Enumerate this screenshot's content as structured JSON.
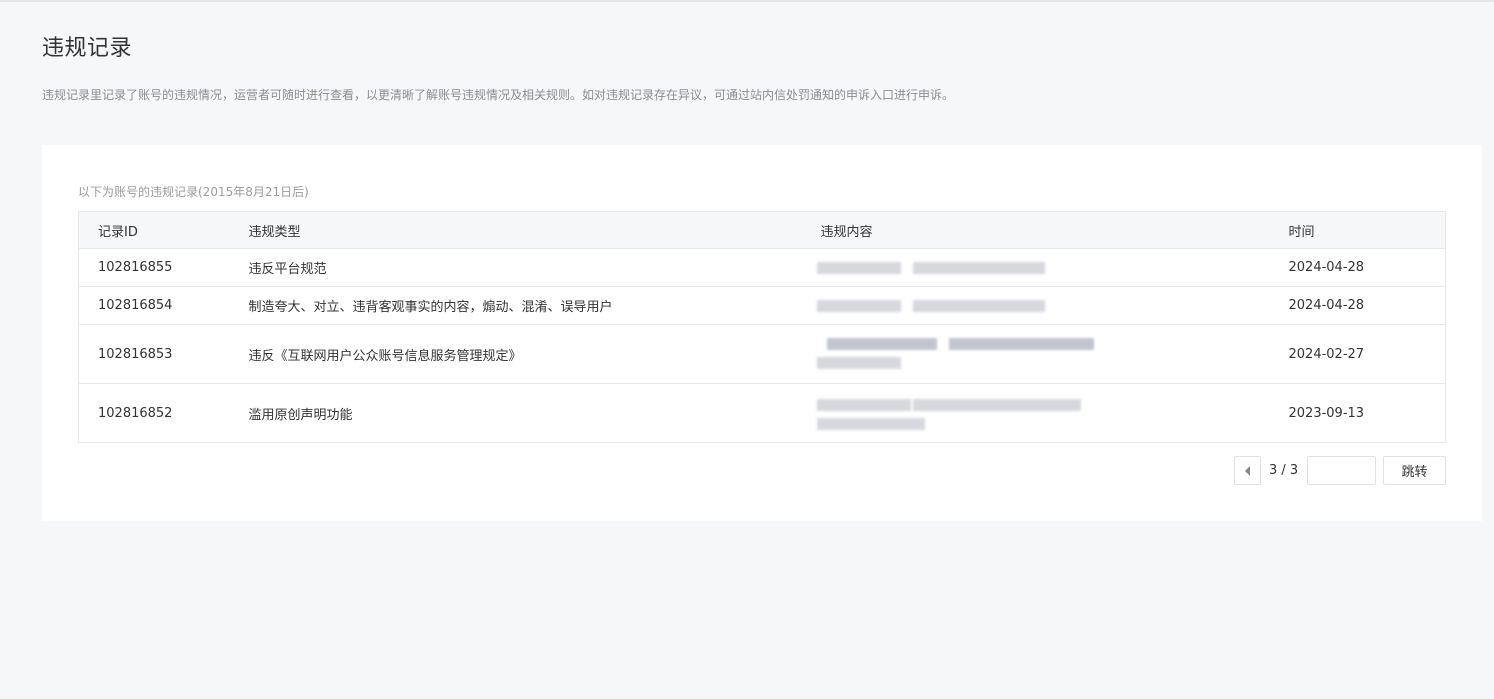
{
  "page": {
    "title": "违规记录",
    "description": "违规记录里记录了账号的违规情况，运营者可随时进行查看，以更清晰了解账号违规情况及相关规则。如对违规记录存在异议，可通过站内信处罚通知的申诉入口进行申诉。"
  },
  "records": {
    "caption": "以下为账号的违规记录(2015年8月21日后)",
    "columns": {
      "id": "记录ID",
      "type": "违规类型",
      "content": "违规内容",
      "time": "时间"
    },
    "rows": [
      {
        "id": "102816855",
        "type": "违反平台规范",
        "time": "2024-04-28"
      },
      {
        "id": "102816854",
        "type": "制造夸大、对立、违背客观事实的内容，煽动、混淆、误导用户",
        "time": "2024-04-28"
      },
      {
        "id": "102816853",
        "type": "违反《互联网用户公众账号信息服务管理规定》",
        "time": "2024-02-27"
      },
      {
        "id": "102816852",
        "type": "滥用原创声明功能",
        "time": "2023-09-13"
      }
    ]
  },
  "pager": {
    "label": "3 / 3",
    "input_value": "",
    "go_label": "跳转"
  },
  "icons": {
    "prev": "caret-left-icon"
  }
}
